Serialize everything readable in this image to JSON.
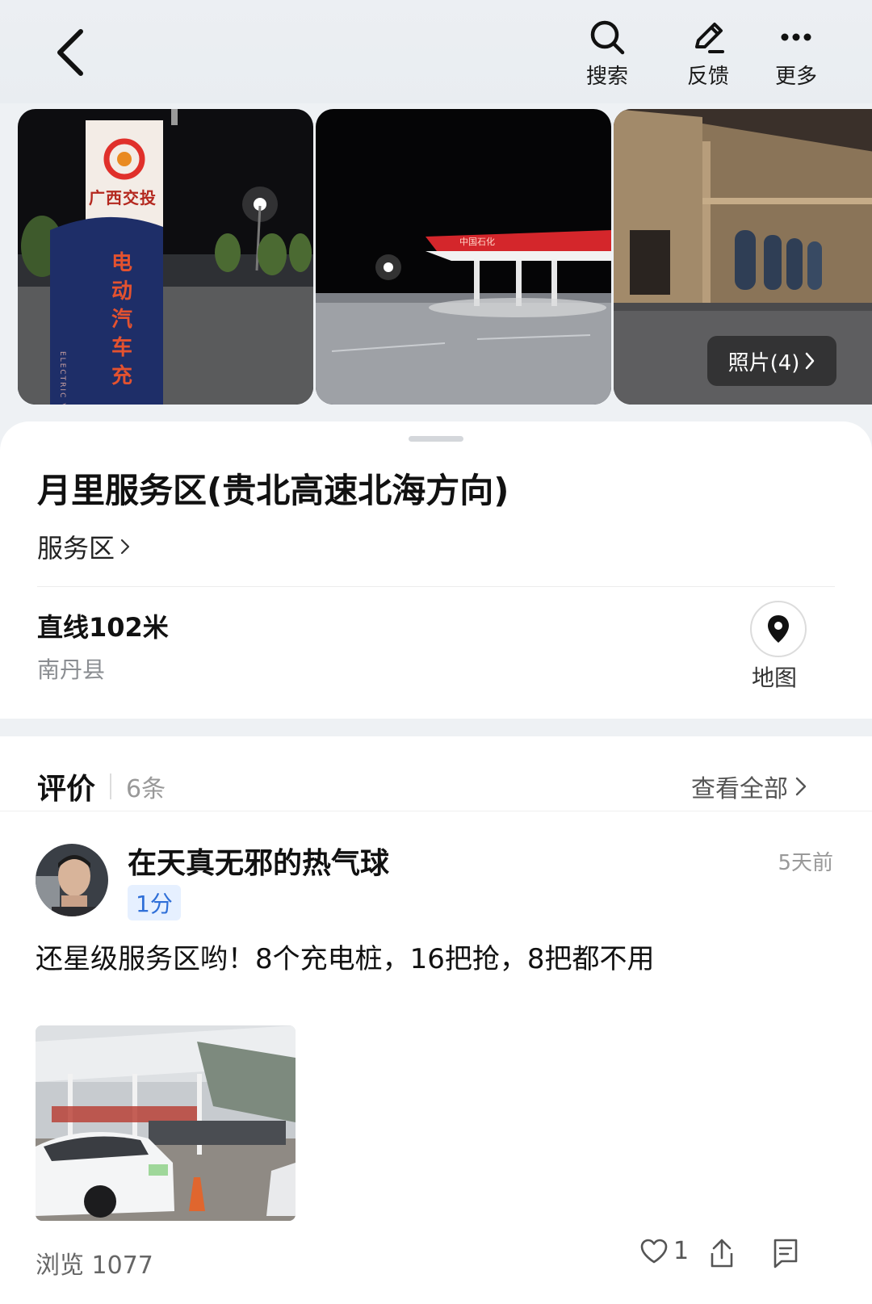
{
  "toolbar": {
    "search_label": "搜索",
    "feedback_label": "反馈",
    "more_label": "更多"
  },
  "gallery": {
    "photo1_sign_brand": "广西交投",
    "photo1_sign_text": "电动汽车充",
    "photo1_sign_en": "ELECTRIC VEHICLE CHARGING",
    "photo2_canopy_text": "中国石化",
    "photos_chip": "照片(4)"
  },
  "place": {
    "title": "月里服务区(贵北高速北海方向)",
    "category": "服务区",
    "distance": "直线102米",
    "county": "南丹县",
    "map_label": "地图"
  },
  "reviews": {
    "title": "评价",
    "count": "6条",
    "view_all": "查看全部",
    "items": [
      {
        "username": "在天真无邪的热气球",
        "score": "1分",
        "time": "5天前",
        "text": "还星级服务区哟！8个充电桩，16把抢，8把都不用",
        "views": "浏览 1077",
        "likes": "1"
      }
    ]
  }
}
